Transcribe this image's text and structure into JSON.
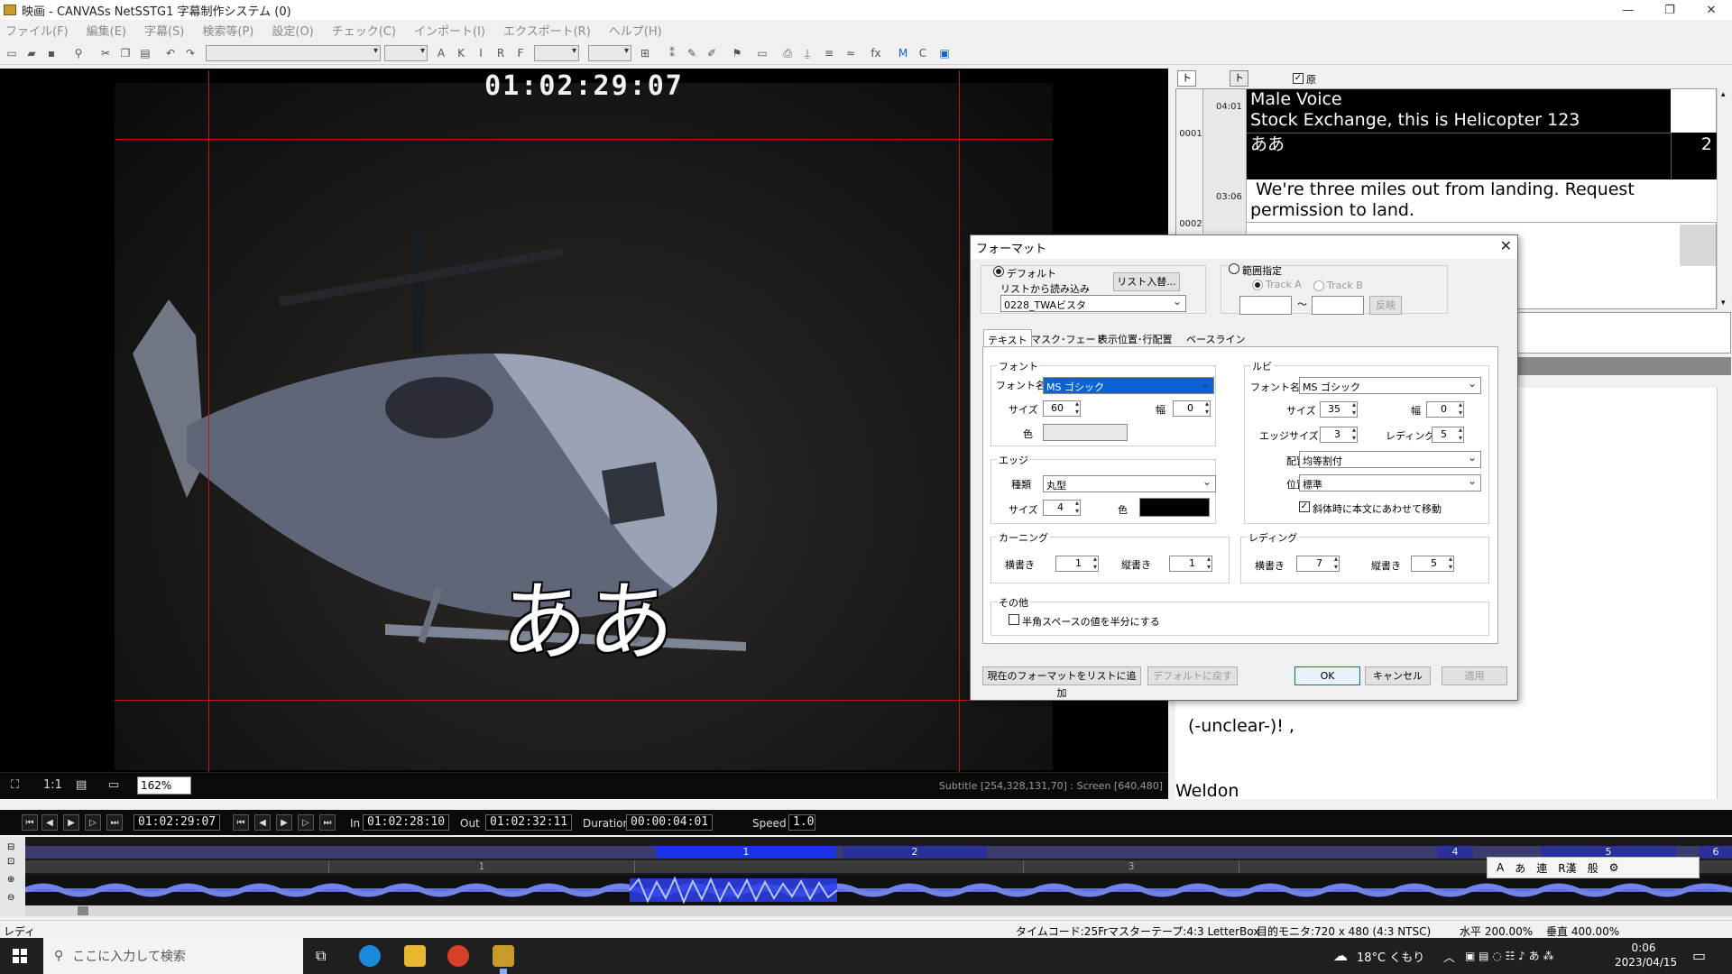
{
  "window": {
    "title": "映画 - CANVASs NetSSTG1 字幕制作システム (0)"
  },
  "menu": [
    "ファイル(F)",
    "編集(E)",
    "字幕(S)",
    "検索等(P)",
    "設定(O)",
    "チェック(C)",
    "インポート(I)",
    "エクスポート(R)",
    "ヘルプ(H)"
  ],
  "video": {
    "timecode": "01:02:29:07",
    "subtitle": "ああ",
    "zoom_ratio": "1:1",
    "zoom_select": "162%",
    "info": "Subtitle [254,328,131,70] : Screen [640,480]"
  },
  "transport": {
    "current": "01:02:29:07",
    "in_label": "In",
    "in": "01:02:28:10",
    "out_label": "Out",
    "out": "01:02:32:11",
    "duration_label": "Duration",
    "duration": "00:00:04:01",
    "speed_label": "Speed",
    "speed": "1.0"
  },
  "timeline": {
    "track_a": [
      "1",
      "2",
      "4",
      "5",
      "6"
    ],
    "track_b": [
      "1",
      "3"
    ]
  },
  "right_panel": {
    "tab_a": "トラック A",
    "tab_b": "トラック B",
    "original_label": "原文",
    "original_checked": true,
    "rows": [
      {
        "num": "0001",
        "tc": "04:01",
        "lines": [
          "Male Voice",
          "Stock Exchange, this is Helicopter 123"
        ],
        "translation": "ああ",
        "count": "2"
      },
      {
        "num": "0002",
        "tc": "03:06",
        "lines": [
          "We're three miles out from landing. Request",
          "permission to land."
        ]
      }
    ],
    "lower_lines": [
      "(-unclear-)! ,",
      "Weldon"
    ]
  },
  "dialog": {
    "title": "フォーマット",
    "default_label": "デフォルト",
    "list_read_label": "リストから読み込み",
    "list_swap_btn": "リスト入替...",
    "list_value": "0228_TWAビスタ",
    "range_label": "範囲指定",
    "track_a": "Track A",
    "track_b": "Track B",
    "tilde": "〜",
    "reflect_btn": "反映",
    "tabs": [
      "テキスト",
      "マスク･フェード",
      "表示位置･行配置",
      "ベースライン"
    ],
    "font": {
      "group": "フォント",
      "name_label": "フォント名",
      "name": "MS ゴシック",
      "size_label": "サイズ",
      "size": "60",
      "width_label": "幅",
      "width": "0",
      "color_label": "色",
      "color": "#e8e8e8"
    },
    "edge": {
      "group": "エッジ",
      "type_label": "種類",
      "type": "丸型",
      "size_label": "サイズ",
      "size": "4",
      "color_label": "色",
      "color": "#000000"
    },
    "ruby": {
      "group": "ルビ",
      "name_label": "フォント名",
      "name": "MS ゴシック",
      "size_label": "サイズ",
      "size": "35",
      "width_label": "幅",
      "width": "0",
      "edge_size_label": "エッジサイズ",
      "edge_size": "3",
      "leading_label": "レディング",
      "leading": "5",
      "align_label": "配置",
      "align": "均等割付",
      "position_label": "位置",
      "position": "標準",
      "italic_move_label": "斜体時に本文にあわせて移動"
    },
    "kerning": {
      "group": "カーニング",
      "h_label": "横書き",
      "h": "1",
      "v_label": "縦書き",
      "v": "1"
    },
    "leading": {
      "group": "レディング",
      "h_label": "横書き",
      "h": "7",
      "v_label": "縦書き",
      "v": "5"
    },
    "other": {
      "group": "その他",
      "half_space_label": "半角スペースの値を半分にする"
    },
    "buttons": {
      "add_format": "現在のフォーマットをリストに追加",
      "reset_default": "デフォルトに戻す",
      "ok": "OK",
      "cancel": "キャンセル",
      "apply": "適用"
    }
  },
  "status": {
    "left": "レディ",
    "timecode": "タイムコード:25Fr",
    "master": "マスターテープ:4:3 LetterBox",
    "monitor": "目的モニタ:720 x 480 (4:3 NTSC)",
    "horizontal": "水平 200.00%",
    "vertical": "垂直 400.00%"
  },
  "taskbar": {
    "search_placeholder": "ここに入力して検索",
    "weather": "18°C くもり",
    "time": "0:06",
    "date": "2023/04/15"
  },
  "ime": {
    "items": [
      "あ",
      "連",
      "R漢",
      "般"
    ]
  },
  "colors": {
    "accent": "#0a64d8",
    "grid": "#c8101a",
    "subtitle_panel": "#000000"
  }
}
